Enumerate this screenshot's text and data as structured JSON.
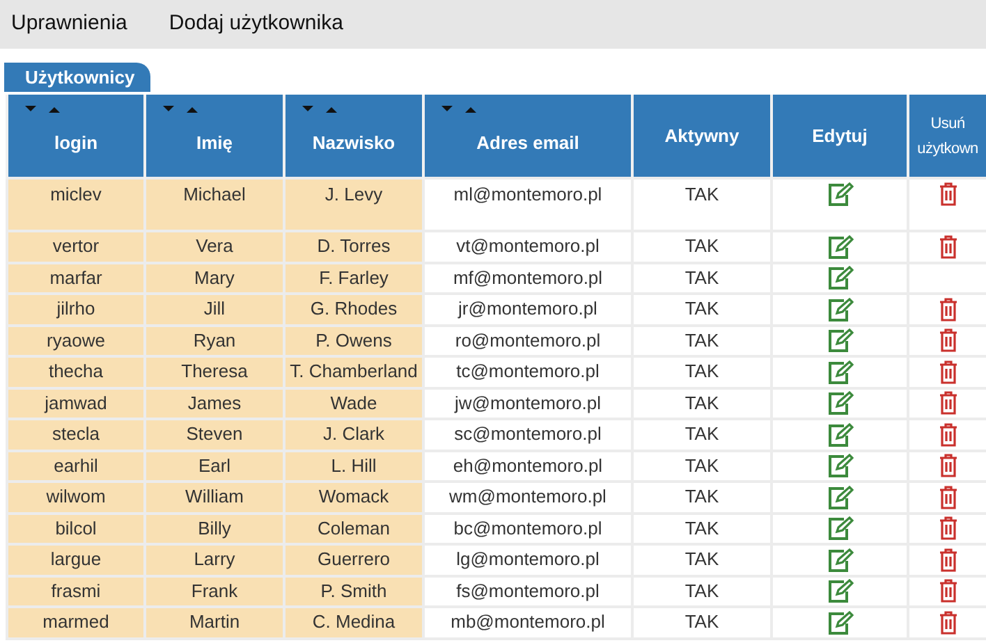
{
  "menu": [
    {
      "label": "Uprawnienia"
    },
    {
      "label": "Dodaj użytkownika"
    }
  ],
  "tab": {
    "label": "Użytkownicy",
    "selected": true
  },
  "table": {
    "columns": [
      {
        "label": "login",
        "sortable": true
      },
      {
        "label": "Imię",
        "sortable": true
      },
      {
        "label": "Nazwisko",
        "sortable": true
      },
      {
        "label": "Adres email",
        "sortable": true
      },
      {
        "label": "Aktywny",
        "sortable": false
      },
      {
        "label": "Edytuj",
        "sortable": false
      },
      {
        "label": "Usuń użytkown",
        "sortable": false
      }
    ],
    "rows": [
      {
        "login": "miclev",
        "first": "Michael",
        "last": "J. Levy",
        "email": "ml@montemoro.pl",
        "active": "TAK",
        "deletable": true
      },
      {
        "login": "vertor",
        "first": "Vera",
        "last": "D. Torres",
        "email": "vt@montemoro.pl",
        "active": "TAK",
        "deletable": true
      },
      {
        "login": "marfar",
        "first": "Mary",
        "last": "F. Farley",
        "email": "mf@montemoro.pl",
        "active": "TAK",
        "deletable": false
      },
      {
        "login": "jilrho",
        "first": "Jill",
        "last": "G. Rhodes",
        "email": "jr@montemoro.pl",
        "active": "TAK",
        "deletable": true
      },
      {
        "login": "ryaowe",
        "first": "Ryan",
        "last": "P. Owens",
        "email": "ro@montemoro.pl",
        "active": "TAK",
        "deletable": true
      },
      {
        "login": "thecha",
        "first": "Theresa",
        "last": "T. Chamberland",
        "email": "tc@montemoro.pl",
        "active": "TAK",
        "deletable": true
      },
      {
        "login": "jamwad",
        "first": "James",
        "last": "Wade",
        "email": "jw@montemoro.pl",
        "active": "TAK",
        "deletable": true
      },
      {
        "login": "stecla",
        "first": "Steven",
        "last": "J. Clark",
        "email": "sc@montemoro.pl",
        "active": "TAK",
        "deletable": true
      },
      {
        "login": "earhil",
        "first": "Earl",
        "last": "L. Hill",
        "email": "eh@montemoro.pl",
        "active": "TAK",
        "deletable": true
      },
      {
        "login": "wilwom",
        "first": "William",
        "last": "Womack",
        "email": "wm@montemoro.pl",
        "active": "TAK",
        "deletable": true
      },
      {
        "login": "bilcol",
        "first": "Billy",
        "last": "Coleman",
        "email": "bc@montemoro.pl",
        "active": "TAK",
        "deletable": true
      },
      {
        "login": "largue",
        "first": "Larry",
        "last": "Guerrero",
        "email": "lg@montemoro.pl",
        "active": "TAK",
        "deletable": true
      },
      {
        "login": "frasmi",
        "first": "Frank",
        "last": "P. Smith",
        "email": "fs@montemoro.pl",
        "active": "TAK",
        "deletable": true
      },
      {
        "login": "marmed",
        "first": "Martin",
        "last": "C. Medina",
        "email": "mb@montemoro.pl",
        "active": "TAK",
        "deletable": true
      }
    ]
  }
}
